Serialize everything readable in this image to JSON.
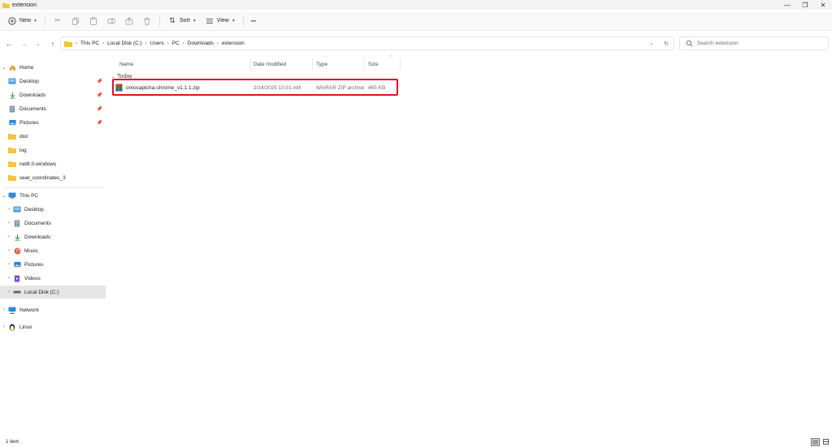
{
  "window": {
    "title": "extension",
    "minimize_glyph": "—",
    "maximize_glyph": "❐",
    "close_glyph": "✕"
  },
  "toolbar": {
    "new_label": "New",
    "sort_label": "Sort",
    "view_label": "View",
    "more_glyph": "···"
  },
  "address": {
    "crumbs": [
      "This PC",
      "Local Disk (C:)",
      "Users",
      "PC",
      "Downloads",
      "extension"
    ],
    "separator": "›"
  },
  "search": {
    "placeholder": "Search extension"
  },
  "nav": {
    "home": "Home",
    "quick_access": [
      {
        "label": "Desktop",
        "icon": "desktop-icon",
        "pinned": true
      },
      {
        "label": "Downloads",
        "icon": "download-icon",
        "pinned": true
      },
      {
        "label": "Documents",
        "icon": "documents-icon",
        "pinned": true
      },
      {
        "label": "Pictures",
        "icon": "pictures-icon",
        "pinned": true
      },
      {
        "label": "dist",
        "icon": "folder-icon",
        "pinned": false
      },
      {
        "label": "log",
        "icon": "folder-icon",
        "pinned": false
      },
      {
        "label": "net8.0-windows",
        "icon": "folder-icon",
        "pinned": false
      },
      {
        "label": "seat_coordinates_3",
        "icon": "folder-icon",
        "pinned": false
      }
    ],
    "this_pc": "This PC",
    "this_pc_children": [
      {
        "label": "Desktop",
        "icon": "desktop-icon"
      },
      {
        "label": "Documents",
        "icon": "documents-icon"
      },
      {
        "label": "Downloads",
        "icon": "download-icon"
      },
      {
        "label": "Music",
        "icon": "music-icon"
      },
      {
        "label": "Pictures",
        "icon": "pictures-icon"
      },
      {
        "label": "Videos",
        "icon": "videos-icon"
      },
      {
        "label": "Local Disk (C:)",
        "icon": "drive-icon"
      }
    ],
    "network": "Network",
    "linux": "Linux"
  },
  "columns": {
    "name": "Name",
    "date_modified": "Date modified",
    "type": "Type",
    "size": "Size"
  },
  "group": {
    "label": "Today"
  },
  "files": [
    {
      "name": "omocaptcha-chrome_v1.1.1.zip",
      "date_modified": "2/14/2025 10:01 AM",
      "type": "WinRAR ZIP archive",
      "size": "465 KB"
    }
  ],
  "status": {
    "item_count": "1 item"
  },
  "colors": {
    "highlight_border": "#e0141e",
    "folder": "#f5c242",
    "selected_nav": "#e5e5e5"
  }
}
